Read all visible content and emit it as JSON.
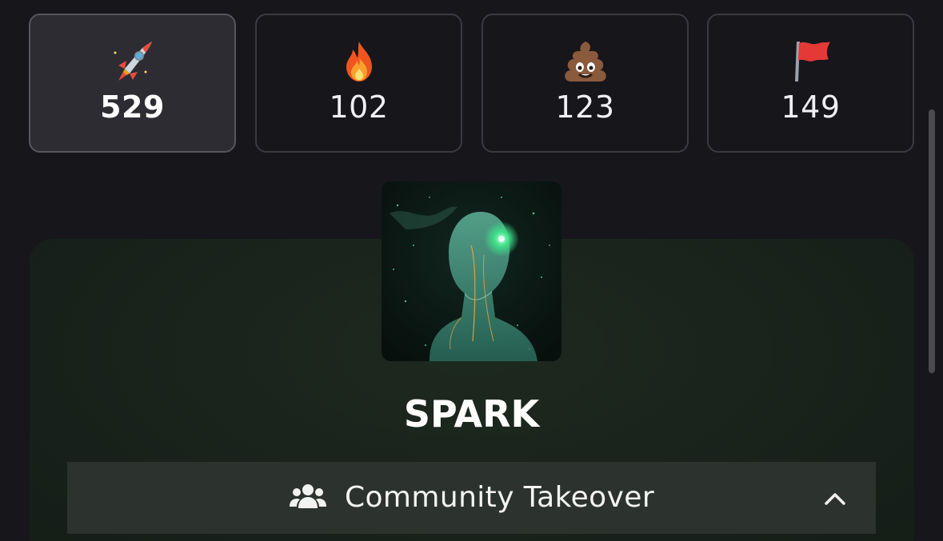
{
  "reactions": [
    {
      "icon": "rocket-icon",
      "count": "529",
      "selected": true
    },
    {
      "icon": "fire-icon",
      "count": "102",
      "selected": false
    },
    {
      "icon": "poop-icon",
      "count": "123",
      "selected": false
    },
    {
      "icon": "red-flag-icon",
      "count": "149",
      "selected": false
    }
  ],
  "token": {
    "name": "SPARK",
    "image": "glowing-green-humanoid-figure-in-space"
  },
  "community": {
    "label": "Community Takeover",
    "icon": "users-icon",
    "toggle_icon": "chevron-up-icon"
  },
  "colors": {
    "background": "#17161b",
    "tile_border": "#3a3a40",
    "tile_selected": "#2d2c32",
    "card_green": "#1d2a1f",
    "bar_bg": "#2c332e"
  }
}
